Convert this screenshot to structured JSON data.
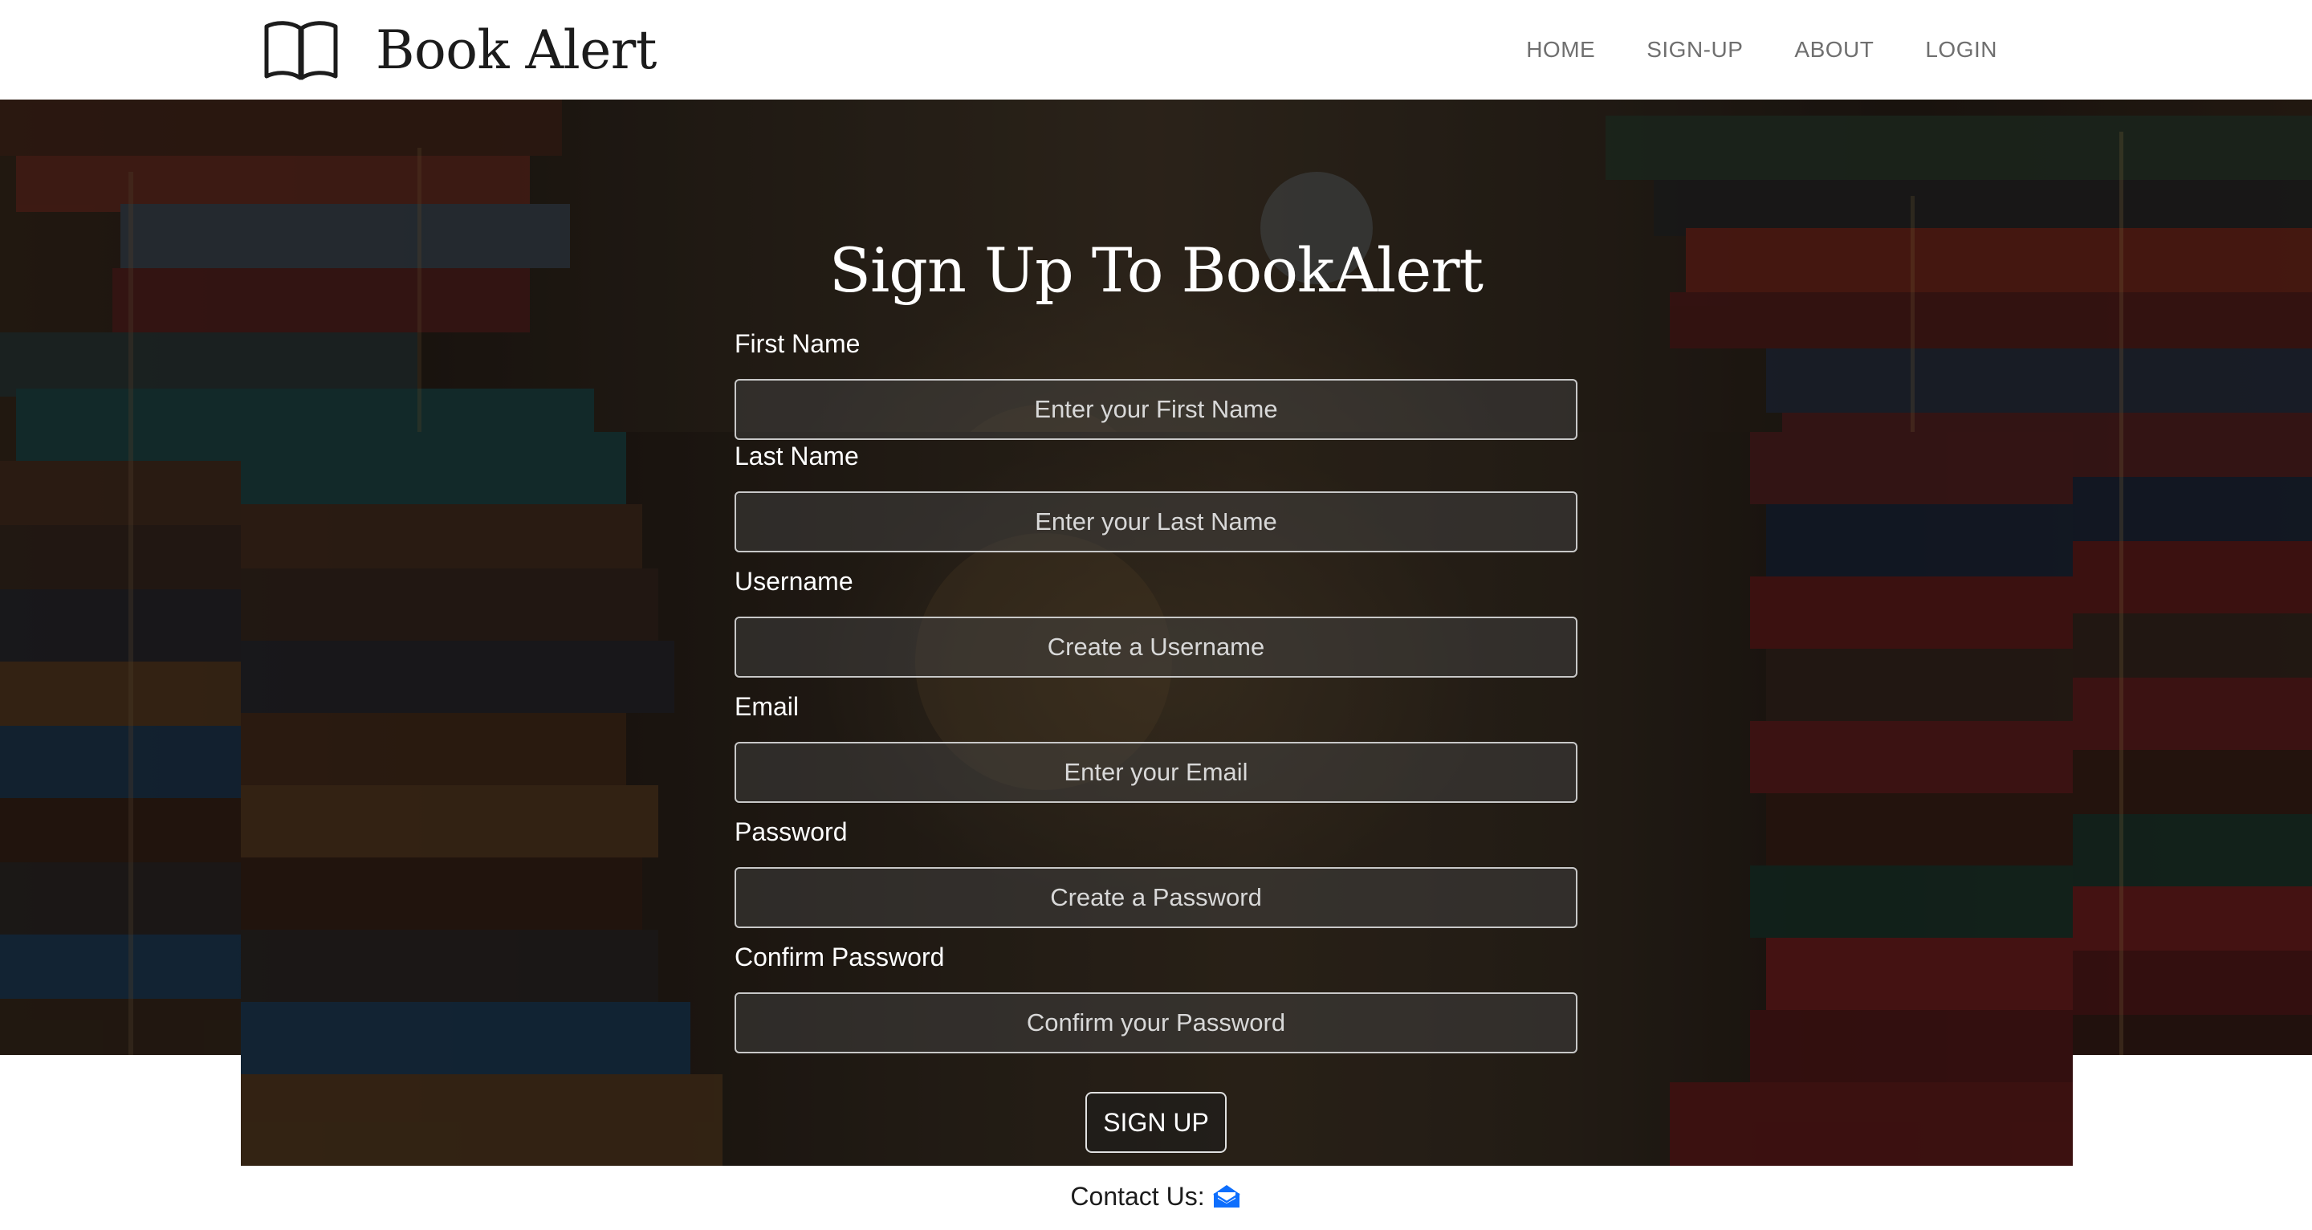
{
  "brand": {
    "name": "Book Alert",
    "icon": "open-book-icon"
  },
  "nav": {
    "items": [
      {
        "label": "HOME"
      },
      {
        "label": "SIGN-UP"
      },
      {
        "label": "ABOUT"
      },
      {
        "label": "LOGIN"
      }
    ]
  },
  "form": {
    "title": "Sign Up To BookAlert",
    "fields": [
      {
        "label": "First Name",
        "placeholder": "Enter your First Name",
        "value": ""
      },
      {
        "label": "Last Name",
        "placeholder": "Enter your Last Name",
        "value": ""
      },
      {
        "label": "Username",
        "placeholder": "Create a Username",
        "value": ""
      },
      {
        "label": "Email",
        "placeholder": "Enter your Email",
        "value": ""
      },
      {
        "label": "Password",
        "placeholder": "Create a Password",
        "value": ""
      },
      {
        "label": "Confirm Password",
        "placeholder": "Confirm your Password",
        "value": ""
      }
    ],
    "submit_label": "SIGN UP"
  },
  "footer": {
    "contact_label": "Contact Us:",
    "contact_icon": "envelope-open-icon",
    "icon_color": "#0d6efd"
  },
  "colors": {
    "header_bg": "#ffffff",
    "nav_text": "#6f6f6f",
    "brand_text": "#1c1c1c",
    "form_text": "#ffffff"
  }
}
